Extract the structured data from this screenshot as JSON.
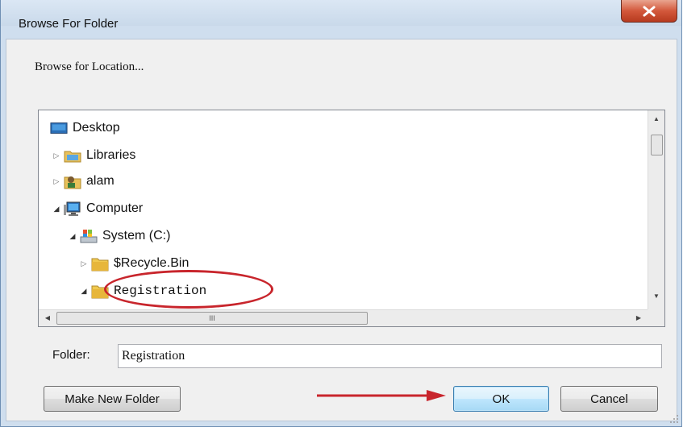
{
  "window": {
    "title": "Browse For Folder"
  },
  "prompt": "Browse for Location...",
  "tree": {
    "items": [
      {
        "label": "Desktop",
        "icon": "desktop-icon"
      },
      {
        "label": "Libraries",
        "icon": "libraries-icon"
      },
      {
        "label": "alam",
        "icon": "user-folder-icon"
      },
      {
        "label": "Computer",
        "icon": "computer-icon"
      },
      {
        "label": "System (C:)",
        "icon": "drive-icon"
      },
      {
        "label": "$Recycle.Bin",
        "icon": "folder-icon"
      },
      {
        "label": "Registration",
        "icon": "folder-icon"
      }
    ]
  },
  "scrollbar": {
    "h_grip": "III"
  },
  "folder": {
    "label": "Folder:",
    "value": "Registration"
  },
  "buttons": {
    "make_new_folder": "Make New Folder",
    "ok": "OK",
    "cancel": "Cancel"
  },
  "colors": {
    "highlight_ellipse": "#c8252c",
    "arrow": "#c8252c",
    "close_button": "#c9452b"
  }
}
